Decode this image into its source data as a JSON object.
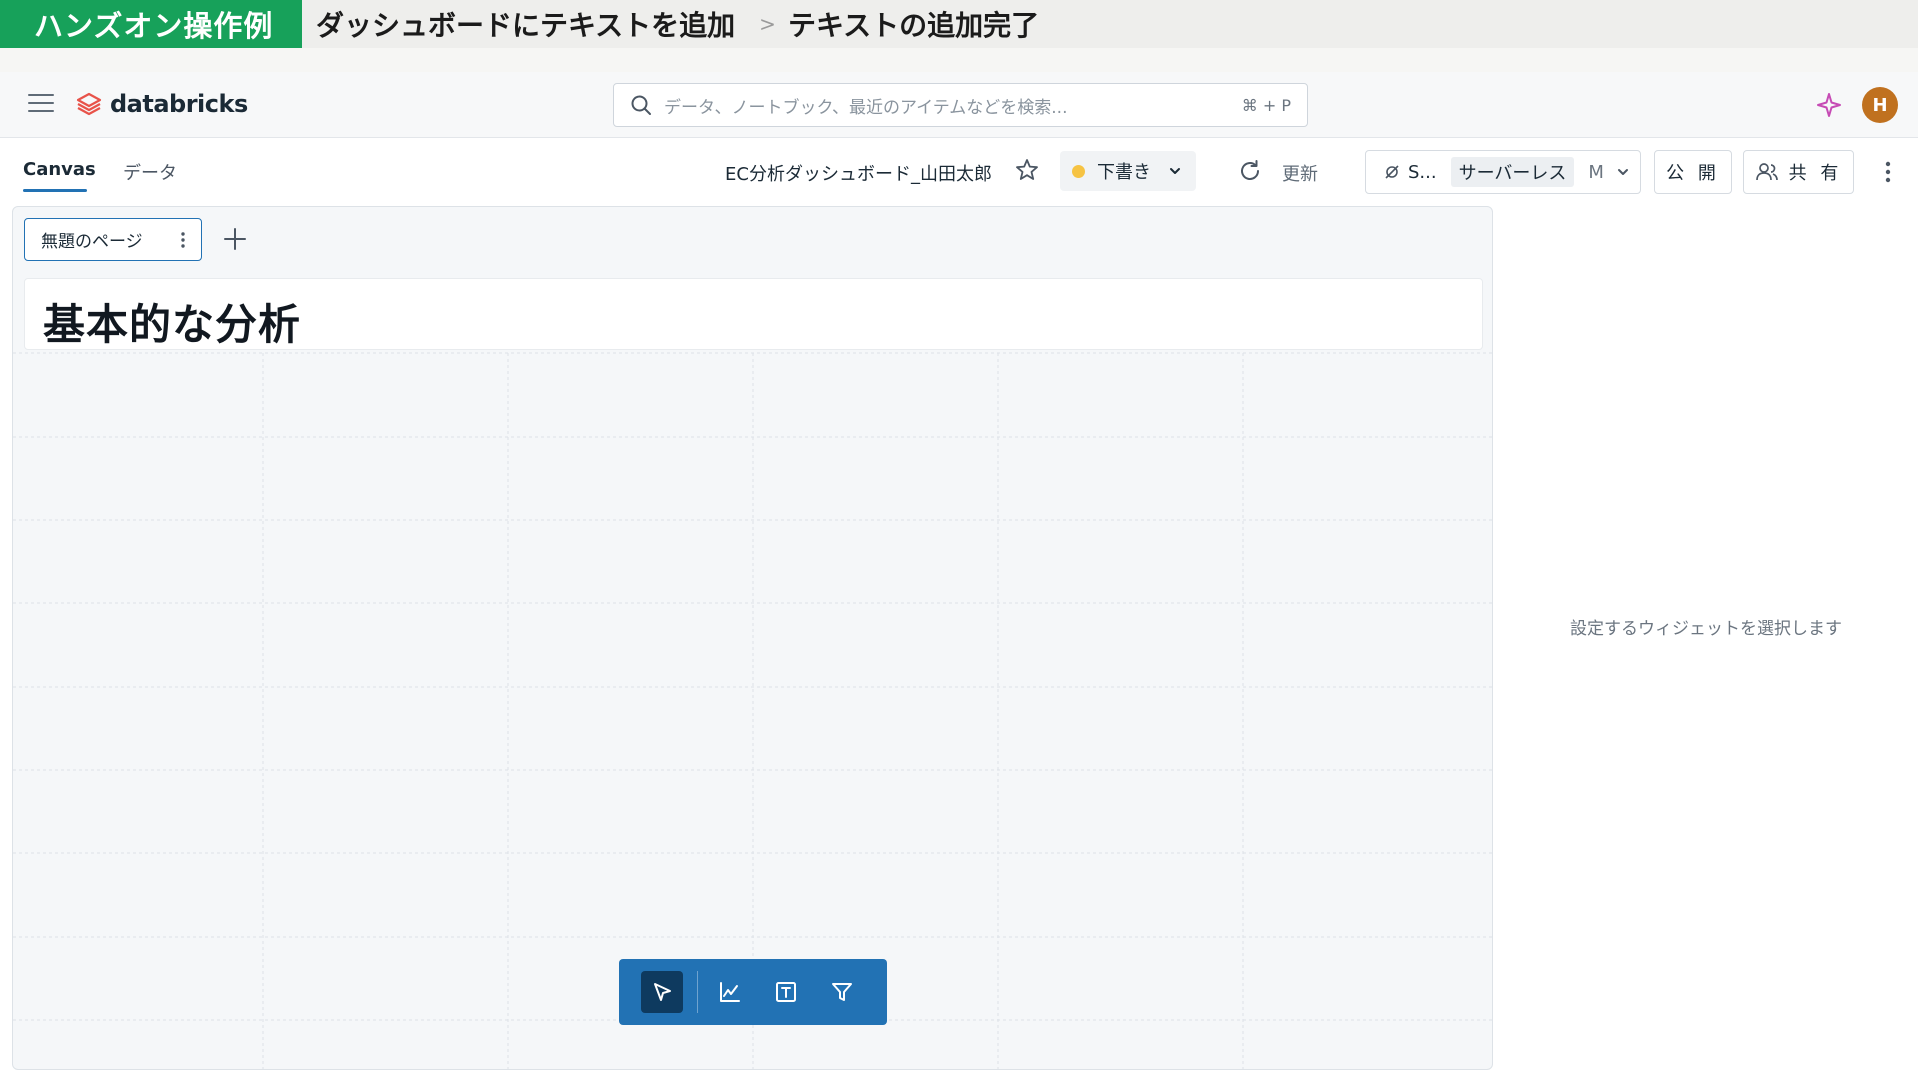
{
  "banner": {
    "tag": "ハンズオン操作例",
    "title": "ダッシュボードにテキストを追加",
    "separator": ">",
    "subtitle": "テキストの追加完了"
  },
  "topnav": {
    "brand": "databricks",
    "search_placeholder": "データ、ノートブック、最近のアイテムなどを検索...",
    "search_shortcut": "⌘ + P",
    "avatar_initial": "H",
    "icons": [
      "menu-icon",
      "databricks-logo-icon",
      "search-icon",
      "assistant-sparkle-icon"
    ]
  },
  "toolbar": {
    "tabs": [
      {
        "label": "Canvas",
        "active": true
      },
      {
        "label": "データ",
        "active": false
      }
    ],
    "dashboard_title": "EC分析ダッシュボード_山田太郎",
    "status": "下書き",
    "refresh_label": "更新",
    "compute": {
      "short": "S...",
      "type": "サーバーレス",
      "size": "M"
    },
    "publish_label": "公 開",
    "share_label": "共 有"
  },
  "canvas": {
    "page_tab": "無題のページ",
    "text_widget": "基本的な分析",
    "floating_tools": [
      "select-icon",
      "chart-icon",
      "text-icon",
      "filter-icon"
    ]
  },
  "side_panel": {
    "hint": "設定するウィジェットを選択します"
  },
  "colors": {
    "banner_green": "#17a15a",
    "accent_blue": "#2272b4",
    "draft_dot": "#f6c343",
    "avatar": "#c0711f"
  }
}
